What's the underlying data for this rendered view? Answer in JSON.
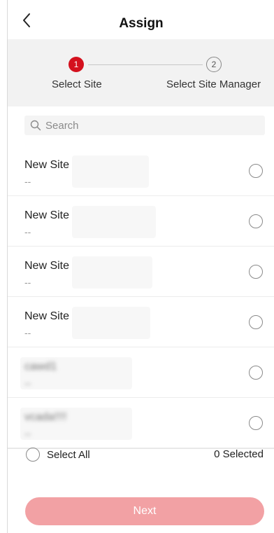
{
  "header": {
    "title": "Assign"
  },
  "stepper": {
    "steps": [
      {
        "number": "1",
        "label": "Select Site",
        "active": true
      },
      {
        "number": "2",
        "label": "Select Site Manager",
        "active": false
      }
    ]
  },
  "search": {
    "placeholder": "Search"
  },
  "sites": [
    {
      "name": "New Site",
      "sub": "--"
    },
    {
      "name": "New Site",
      "sub": "--"
    },
    {
      "name": "New Site",
      "sub": "--"
    },
    {
      "name": "New Site",
      "sub": "--"
    },
    {
      "name": "cawd1",
      "sub": "--"
    },
    {
      "name": "vcada!!!!",
      "sub": "--"
    }
  ],
  "footer": {
    "select_all_label": "Select All",
    "selected_count": "0 Selected",
    "next_label": "Next"
  },
  "colors": {
    "accent": "#d4111e",
    "next_button_disabled": "#f2a1a4",
    "stepper_bg": "#f2f2f2"
  }
}
